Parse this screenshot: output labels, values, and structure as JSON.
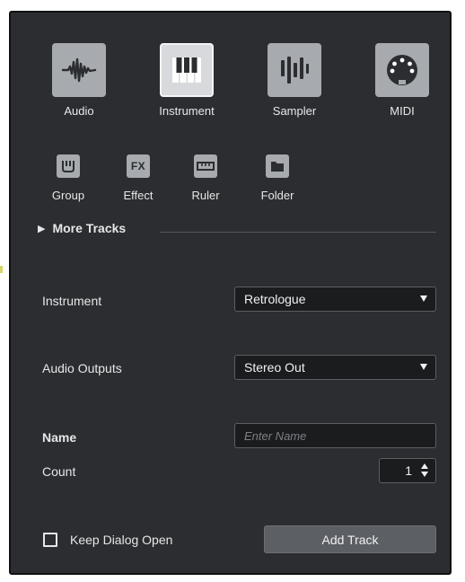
{
  "track_types": {
    "audio": {
      "label": "Audio",
      "icon": "waveform-icon"
    },
    "instrument": {
      "label": "Instrument",
      "icon": "piano-keys-icon",
      "selected": true
    },
    "sampler": {
      "label": "Sampler",
      "icon": "sampler-bars-icon"
    },
    "midi": {
      "label": "MIDI",
      "icon": "midi-connector-icon"
    }
  },
  "small_types": {
    "group": {
      "label": "Group",
      "icon": "group-icon"
    },
    "effect": {
      "label": "Effect",
      "icon": "fx-icon",
      "icon_text": "FX"
    },
    "ruler": {
      "label": "Ruler",
      "icon": "ruler-icon"
    },
    "folder": {
      "label": "Folder",
      "icon": "folder-icon"
    }
  },
  "more_tracks": {
    "label": "More Tracks"
  },
  "fields": {
    "instrument": {
      "label": "Instrument",
      "value": "Retrologue"
    },
    "audio_outputs": {
      "label": "Audio Outputs",
      "value": "Stereo Out"
    },
    "name": {
      "label": "Name",
      "placeholder": "Enter Name"
    },
    "count": {
      "label": "Count",
      "value": "1"
    }
  },
  "footer": {
    "keep_open_label": "Keep Dialog Open",
    "keep_open_checked": false,
    "add_track_label": "Add Track"
  },
  "colors": {
    "dialog_bg": "#2b2d30",
    "icon_bg": "#a7aaae",
    "icon_selected_bg": "#d7d9dc",
    "field_bg": "#1b1c1e",
    "button_bg": "#5c5f63"
  }
}
